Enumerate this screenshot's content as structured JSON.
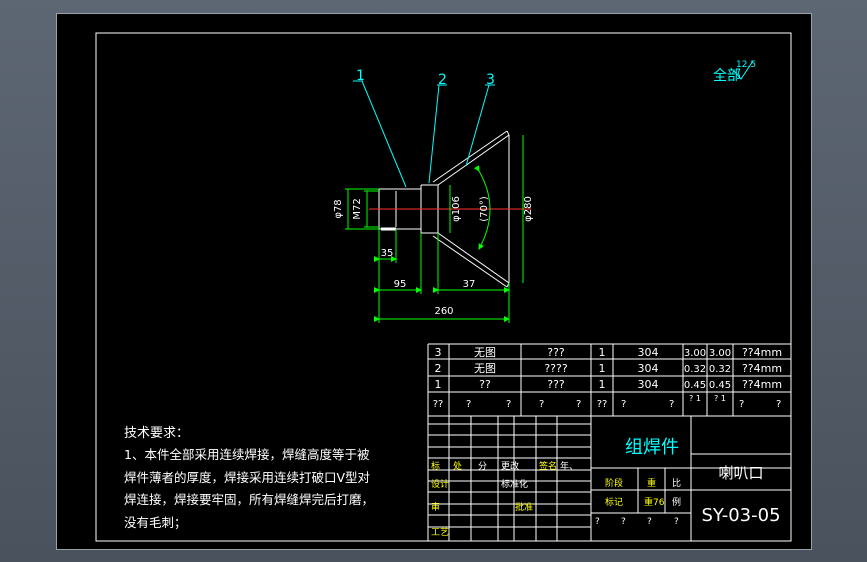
{
  "roughness": {
    "prefix": "全部",
    "value": "12.5"
  },
  "balloons": [
    "1",
    "2",
    "3"
  ],
  "dimensions": {
    "dia_left": "φ78",
    "thread": "M72",
    "dia_mid": "φ106",
    "dia_right": "φ280",
    "angle": "(70°)",
    "len_35": "35",
    "len_95": "95",
    "len_37": "37",
    "len_260": "260"
  },
  "tech_requirements": {
    "title": "技术要求：",
    "lines": [
      "1、本件全部采用连续焊接，焊缝高度等于被",
      "焊件薄者的厚度，焊接采用连续打破口V型对",
      "焊连接，焊接要牢固，所有焊缝焊完后打磨，",
      "没有毛刺；"
    ]
  },
  "bom": {
    "rows": [
      [
        "3",
        "无图",
        "???",
        "1",
        "304",
        "3.00",
        "3.00",
        "??4mm"
      ],
      [
        "2",
        "无图",
        "????",
        "1",
        "304",
        "0.32",
        "0.32",
        "??4mm"
      ],
      [
        "1",
        "??",
        "???",
        "1",
        "304",
        "0.45",
        "0.45",
        "??4mm"
      ]
    ],
    "header": [
      "??",
      "?",
      "?",
      "?",
      "?",
      "??",
      "?",
      "?",
      "? 1",
      "? 1",
      "?",
      "?"
    ]
  },
  "title_block": {
    "assembly_label": "组焊件",
    "part_name": "喇叭口",
    "drawing_no": "SY-03-05",
    "left_labels": [
      "标",
      "处",
      "分",
      "更改",
      "签名",
      "年、",
      "设计",
      "标准化",
      "审",
      "工艺",
      "批准"
    ],
    "mid_labels": [
      "阶段",
      "重",
      "比",
      "标记",
      "重76",
      "例",
      "?",
      "?",
      "?",
      "?"
    ]
  }
}
